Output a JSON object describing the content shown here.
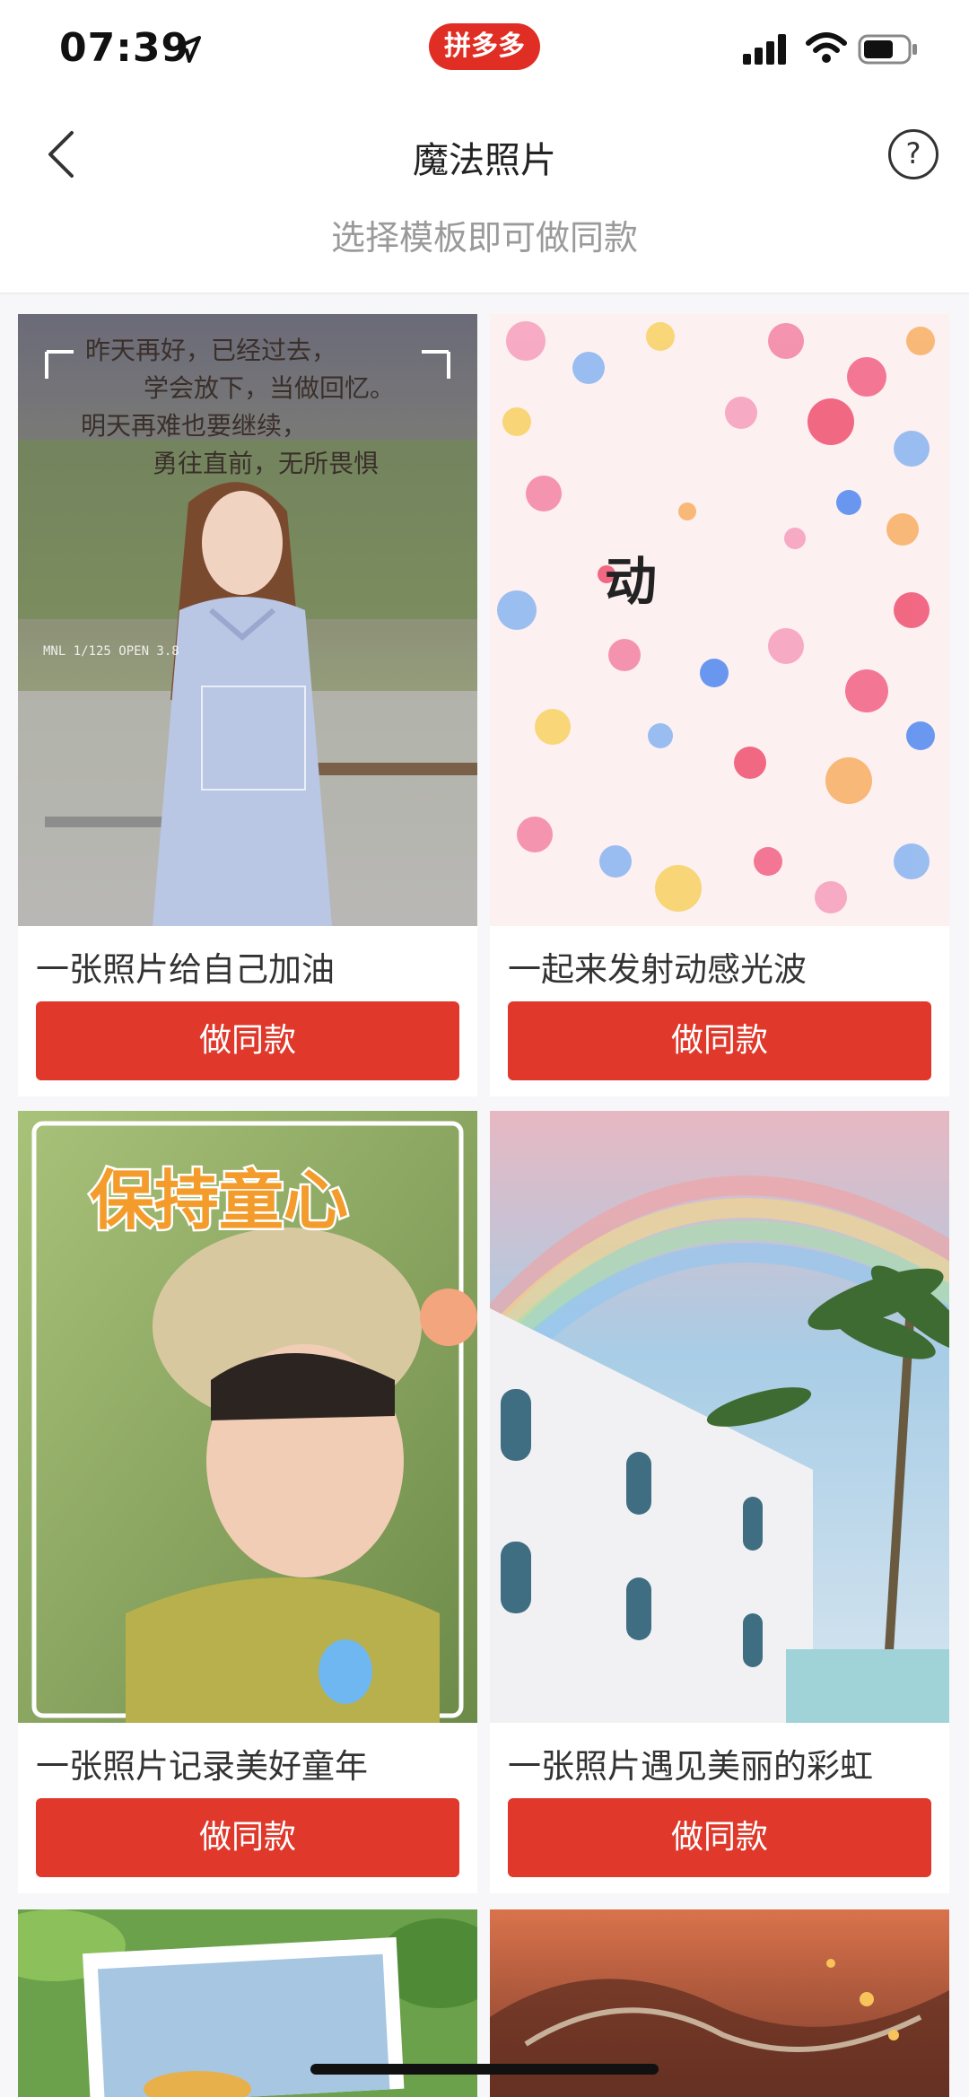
{
  "status": {
    "time": "07:39",
    "brand": "拼多多"
  },
  "nav": {
    "title": "魔法照片",
    "help": "?"
  },
  "subtitle": "选择模板即可做同款",
  "cards": [
    {
      "title": "一张照片给自己加油",
      "button": "做同款",
      "overlay_lines": [
        "昨天再好，已经过去，",
        "学会放下，当做回忆。",
        "明天再难也要继续，",
        "勇往直前，无所畏惧"
      ],
      "camera_text": "MNL 1/125 OPEN 3.8"
    },
    {
      "title": "一起来发射动感光波",
      "button": "做同款",
      "overlay": "动"
    },
    {
      "title": "一张照片记录美好童年",
      "button": "做同款",
      "overlay": "保持童心"
    },
    {
      "title": "一张照片遇见美丽的彩虹",
      "button": "做同款"
    }
  ]
}
